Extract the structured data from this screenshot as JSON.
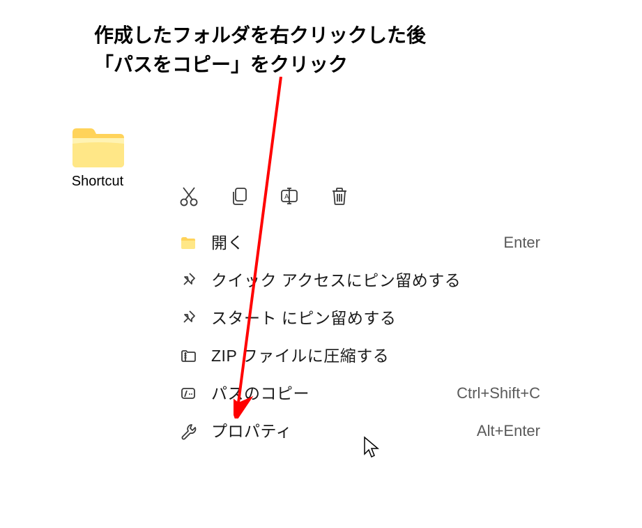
{
  "instruction": {
    "line1": "作成したフォルダを右クリックした後",
    "line2": "「パスをコピー」をクリック"
  },
  "folder": {
    "label": "Shortcut"
  },
  "quick_actions": {
    "cut": "cut-icon",
    "copy": "copy-icon",
    "rename": "rename-icon",
    "delete": "delete-icon"
  },
  "menu": {
    "open": {
      "icon": "folder-open-icon",
      "label": "開く",
      "shortcut": "Enter"
    },
    "pin_quick": {
      "icon": "pin-icon",
      "label": "クイック アクセスにピン留めする",
      "shortcut": ""
    },
    "pin_start": {
      "icon": "pin-icon",
      "label": "スタート にピン留めする",
      "shortcut": ""
    },
    "zip": {
      "icon": "zip-icon",
      "label": "ZIP ファイルに圧縮する",
      "shortcut": ""
    },
    "copy_path": {
      "icon": "copy-path-icon",
      "label": "パスのコピー",
      "shortcut": "Ctrl+Shift+C"
    },
    "properties": {
      "icon": "wrench-icon",
      "label": "プロパティ",
      "shortcut": "Alt+Enter"
    }
  },
  "colors": {
    "arrow": "#ff0000",
    "icon": "#3a3a3a",
    "folder_body": "#ffe787",
    "folder_tab": "#ffd35a",
    "folder_shine": "#fff9d9"
  }
}
